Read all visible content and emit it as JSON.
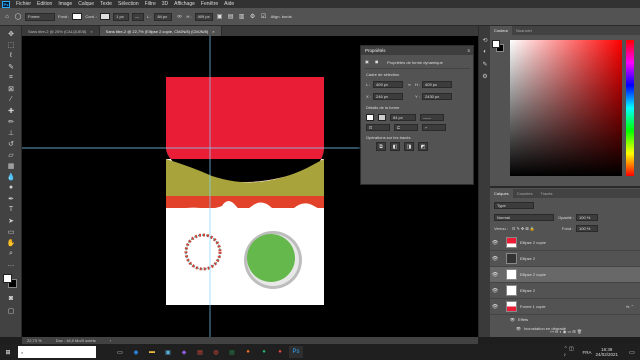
{
  "menubar": {
    "logo": "Ps",
    "items": [
      "Fichier",
      "Edition",
      "Image",
      "Calque",
      "Texte",
      "Sélection",
      "Filtre",
      "3D",
      "Affichage",
      "Fenêtre",
      "Aide"
    ]
  },
  "options": {
    "mode_label": "Forme",
    "fill_label": "Fond :",
    "stroke_label": "Cont. :",
    "stroke_width": "1 px",
    "w_label": "L :",
    "w_value": "84 px",
    "h_label": "H :",
    "h_value": "409 px",
    "align_label": "Align. bords"
  },
  "tabs": [
    {
      "label": "Sans titre-2 @ 25% (CALQUE/8)",
      "close": "×"
    },
    {
      "label": "Sans titre-2 @ 22,7% (Ellipse 2 copie, CMJN/8) (CMJN/8)",
      "close": "×"
    }
  ],
  "properties": {
    "title": "Propriétés",
    "subtitle": "Propriétés de forme dynamique",
    "transform_section": "Cadre de sélection",
    "w": "409 px",
    "h": "409 px",
    "x": "246 px",
    "y": "2430 px",
    "appearance_section": "Détails de la forme",
    "stroke": "84 px",
    "pathops_section": "Opérations sur les tracés"
  },
  "color_panel": {
    "tabs": [
      "Couleur",
      "Nuancier"
    ],
    "colors": {
      "hue": "#ff0000",
      "fg": "#ffffff",
      "bg": "#000000"
    }
  },
  "layers_panel": {
    "tabs": [
      "Calques",
      "Couches",
      "Tracés"
    ],
    "kind": "Type",
    "blend": "Normal",
    "opacity_label": "Opacité :",
    "opacity": "100 %",
    "lock_label": "Verrou :",
    "fill_label": "Fond :",
    "fill": "100 %",
    "layers": [
      {
        "name": "Ellipse 2 copie",
        "selected": false
      },
      {
        "name": "Ellipse 2",
        "selected": false
      },
      {
        "name": "Ellipse 2 copie",
        "selected": true
      },
      {
        "name": "Ellipse 2",
        "selected": false
      },
      {
        "name": "Forme 1 copie",
        "selected": false
      },
      {
        "name": "Effets",
        "selected": false
      },
      {
        "name": "Incrustation en dégradé",
        "selected": false
      }
    ]
  },
  "status": {
    "zoom": "22,73 %",
    "doc": "Doc : 16,0 Mo/0 octets"
  },
  "taskbar": {
    "lang": "FRA",
    "time": "16:39",
    "date": "24/02/2021"
  }
}
